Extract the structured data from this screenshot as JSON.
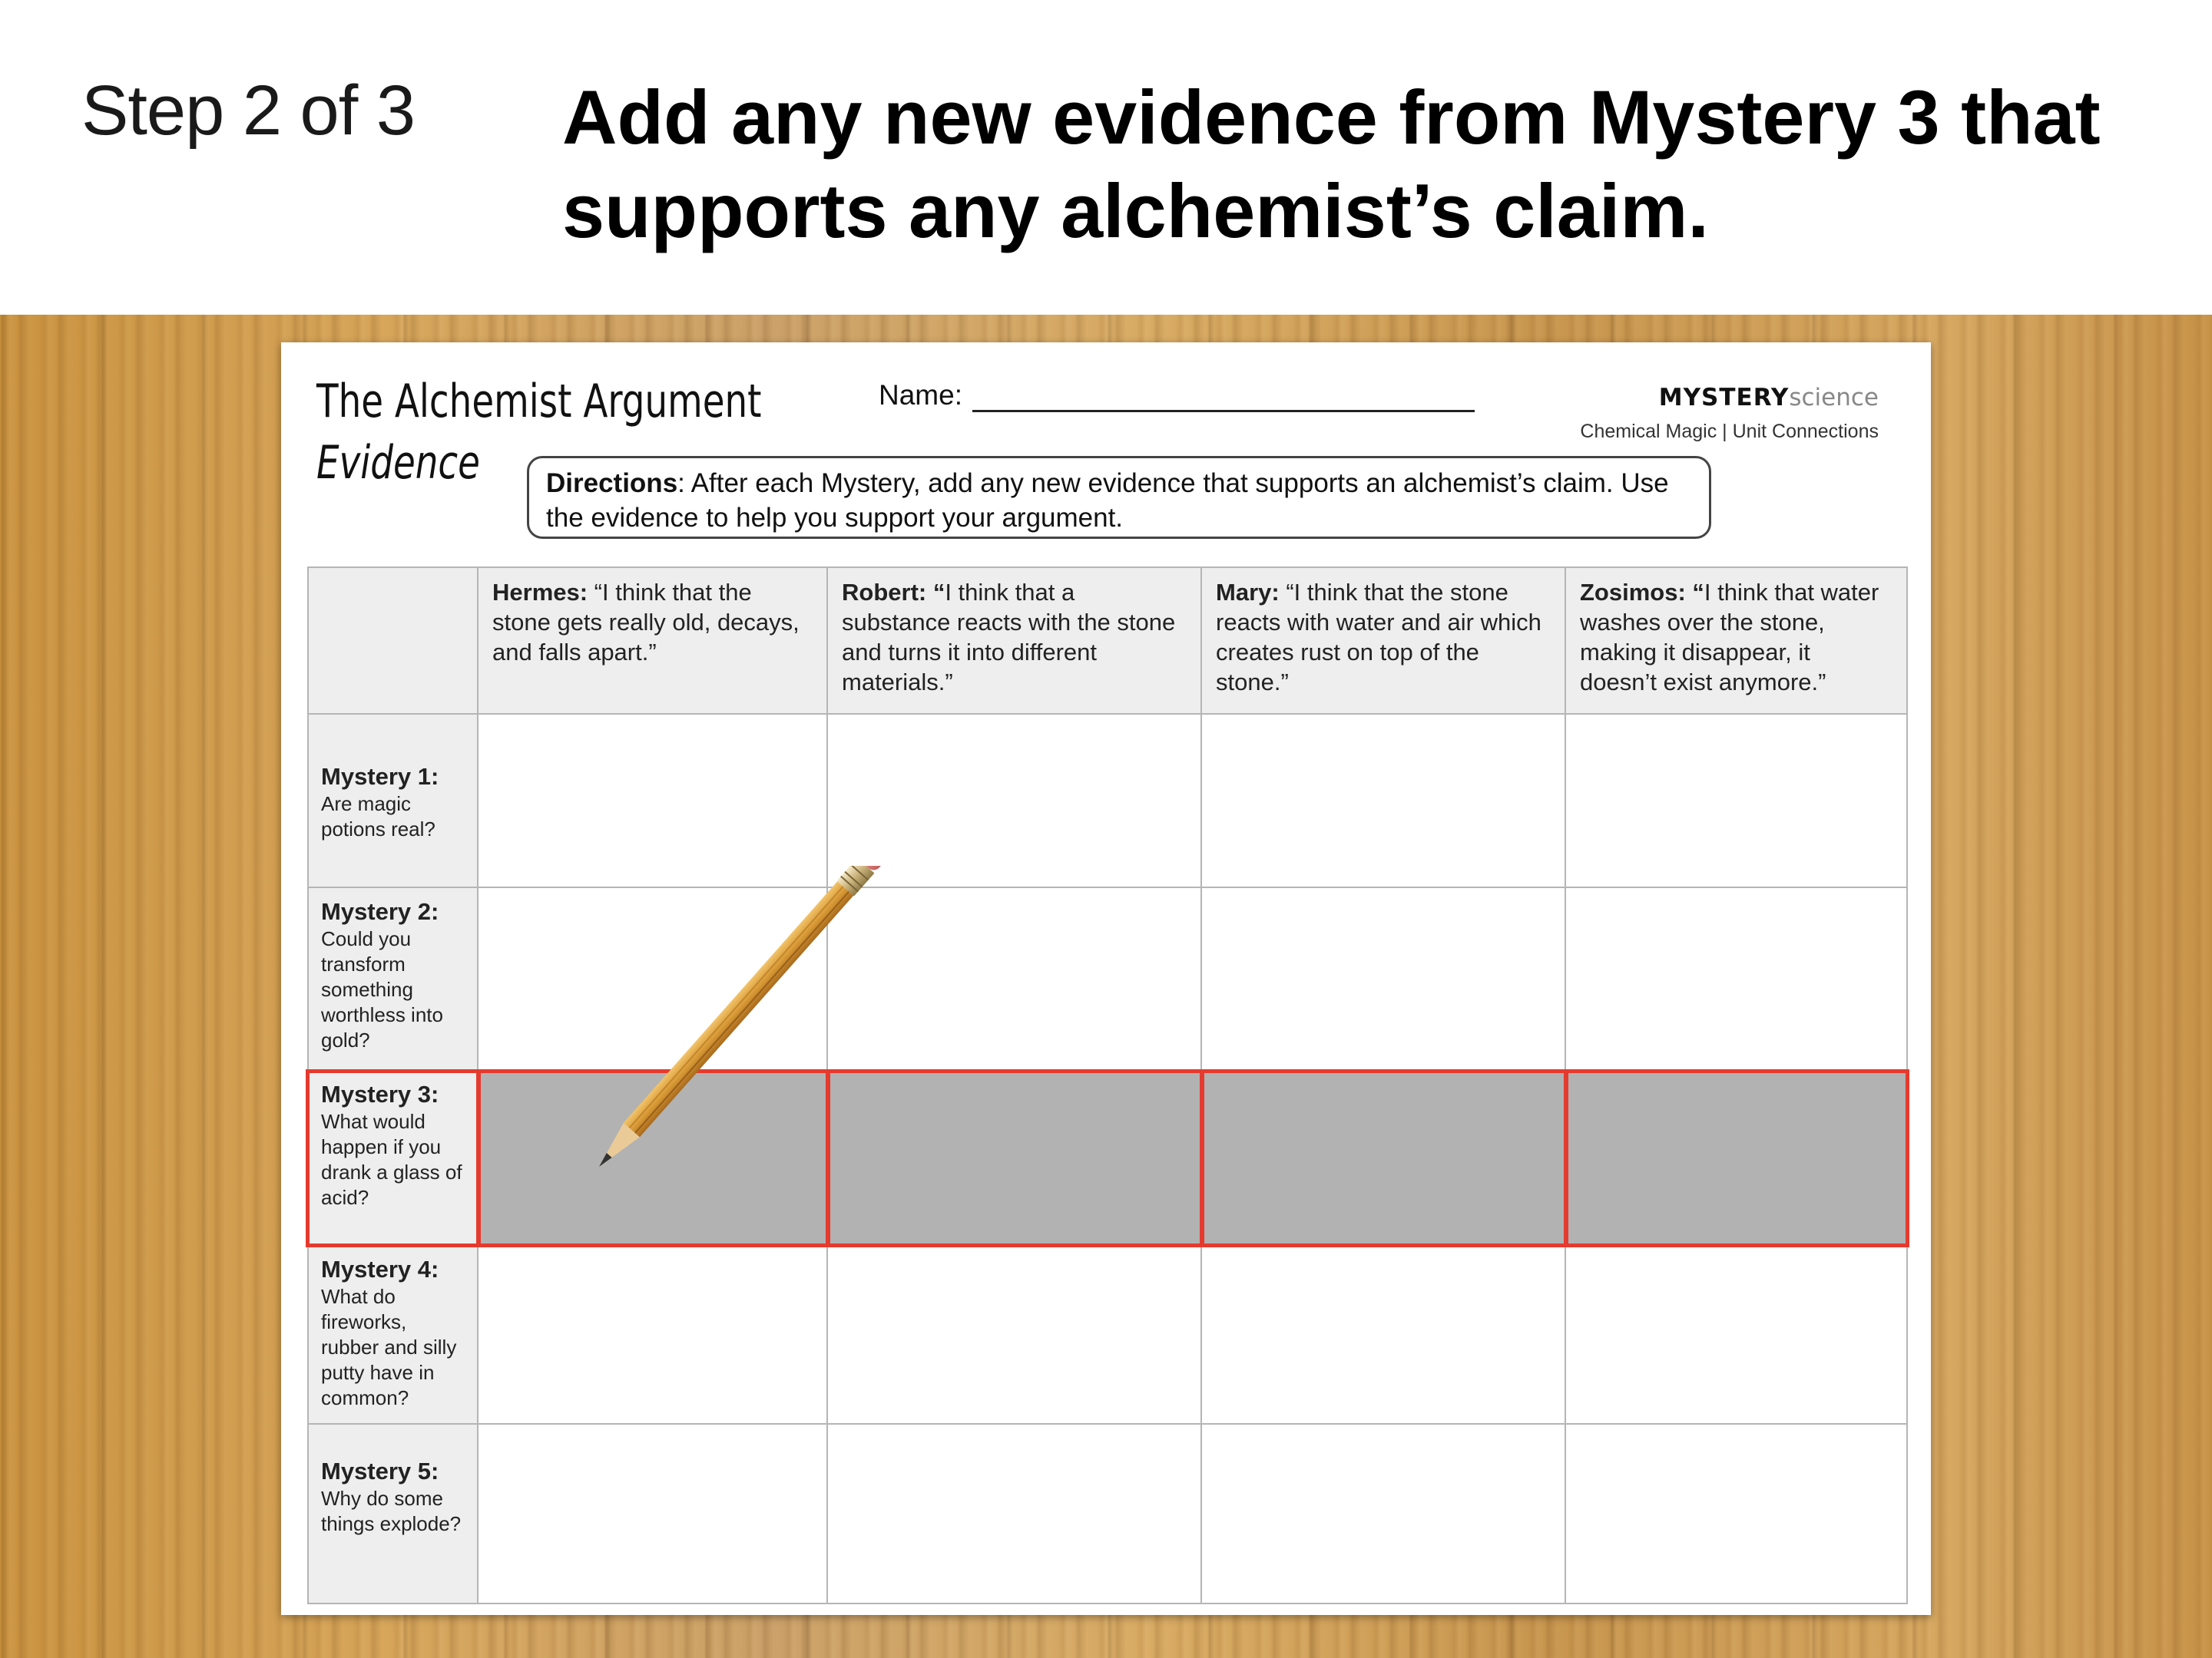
{
  "slide": {
    "step_label": "Step 2 of 3",
    "instruction": "Add any new evidence from Mystery 3 that supports any alchemist’s claim."
  },
  "worksheet": {
    "title": "The Alchemist Argument",
    "subtitle": "Evidence",
    "name_label": "Name:",
    "brand_bold": "MYSTERY",
    "brand_light": "science",
    "unit_label": "Chemical Magic | Unit Connections",
    "directions_label": "Directions",
    "directions_text": ": After each Mystery, add any new evidence that supports an alchemist’s claim. Use the evidence to help you support your argument."
  },
  "table": {
    "columns": [
      {
        "name": "Hermes:",
        "quote": " “I think that the stone gets really old, decays, and falls apart.”"
      },
      {
        "name": "Robert: “",
        "quote": "I think that a substance reacts with the stone and turns it into different materials.”"
      },
      {
        "name": "Mary:",
        "quote": " “I think that the stone reacts with water and air which creates rust on top of the stone.”"
      },
      {
        "name": "Zosimos: “",
        "quote": "I think that water washes over the stone, making it disappear, it doesn’t exist anymore.”"
      }
    ],
    "rows": [
      {
        "title": "Mystery 1:",
        "question": "Are magic potions real?"
      },
      {
        "title": "Mystery 2:",
        "question": "Could you transform something worthless into gold?"
      },
      {
        "title": "Mystery 3:",
        "question": "What would happen if you drank a glass of acid?"
      },
      {
        "title": "Mystery 4:",
        "question": "What do fireworks, rubber and silly putty have in common?"
      },
      {
        "title": "Mystery 5:",
        "question": "Why do some things explode?"
      }
    ],
    "highlighted_row": "Mystery 3:",
    "highlight_color": "#e53a2e"
  },
  "icons": {
    "pencil": "pencil-icon"
  }
}
